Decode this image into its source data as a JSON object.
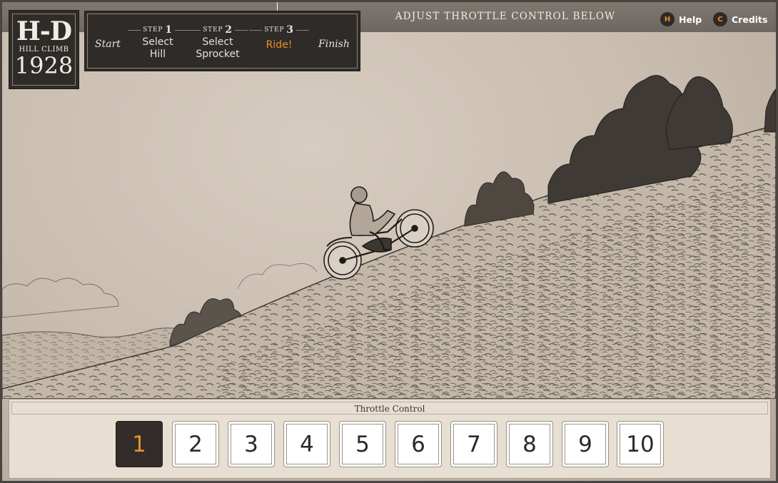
{
  "logo": {
    "mark": "H-D",
    "subtitle": "HILL CLIMB",
    "year": "1928"
  },
  "steps": {
    "start": "Start",
    "finish": "Finish",
    "items": [
      {
        "step_word": "STEP",
        "number": "1",
        "label": "Select Hill",
        "active": false
      },
      {
        "step_word": "STEP",
        "number": "2",
        "label": "Select Sprocket",
        "active": false
      },
      {
        "step_word": "STEP",
        "number": "3",
        "label": "Ride!",
        "active": true
      }
    ]
  },
  "header": {
    "instruction": "ADJUST THROTTLE CONTROL BELOW"
  },
  "top_buttons": [
    {
      "key": "H",
      "label": "Help"
    },
    {
      "key": "C",
      "label": "Credits"
    }
  ],
  "throttle": {
    "title": "Throttle Control",
    "options": [
      "1",
      "2",
      "3",
      "4",
      "5",
      "6",
      "7",
      "8",
      "9",
      "10"
    ],
    "selected": "1"
  },
  "colors": {
    "accent": "#e8902a",
    "dark": "#2f2b28",
    "paper": "#c8bcae"
  }
}
